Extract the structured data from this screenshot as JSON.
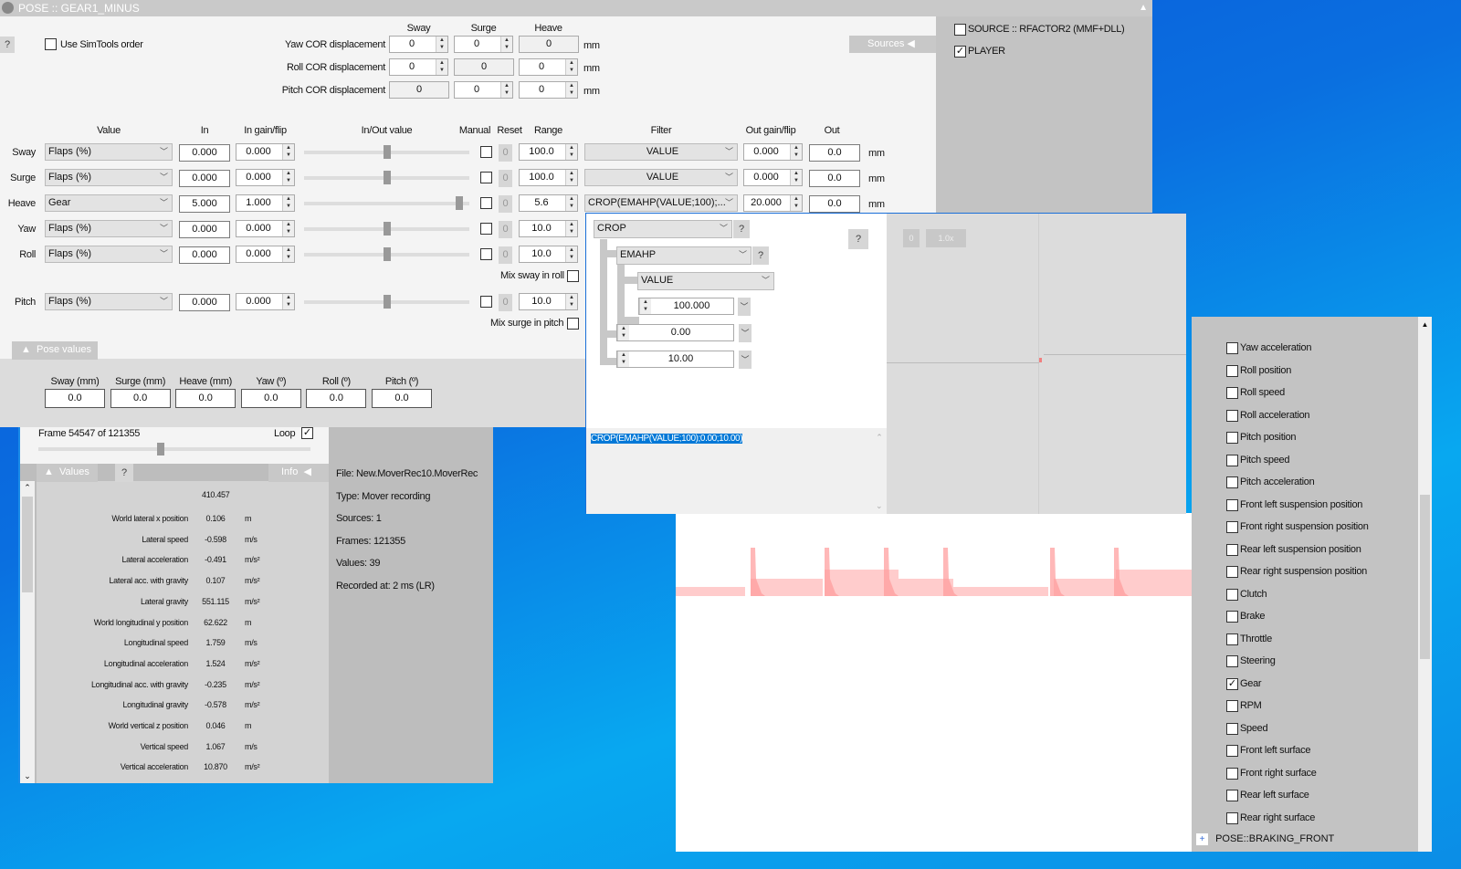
{
  "main_window": {
    "title": "POSE :: GEAR1_MINUS",
    "help": "?",
    "use_simtools_order": "Use SimTools order",
    "sources_button": "Sources",
    "cor": {
      "headers": [
        "Sway",
        "Surge",
        "Heave"
      ],
      "unit": "mm",
      "rows": [
        {
          "label": "Yaw COR displacement",
          "values": [
            "0",
            "0",
            "0"
          ],
          "disabled": [
            false,
            false,
            true
          ]
        },
        {
          "label": "Roll COR displacement",
          "values": [
            "0",
            "0",
            "0"
          ],
          "disabled": [
            false,
            true,
            false
          ]
        },
        {
          "label": "Pitch COR displacement",
          "values": [
            "0",
            "0",
            "0"
          ],
          "disabled": [
            true,
            false,
            false
          ]
        }
      ]
    },
    "columns": {
      "value": "Value",
      "in": "In",
      "in_gain": "In gain/flip",
      "inout": "In/Out value",
      "manual": "Manual",
      "reset": "Reset",
      "range": "Range",
      "filter": "Filter",
      "out_gain": "Out gain/flip",
      "out": "Out"
    },
    "channels": [
      {
        "label": "Sway",
        "value": "Flaps (%)",
        "in": "0.000",
        "gain": "0.000",
        "slider": 0.5,
        "manual": false,
        "reset": "0",
        "range": "100.0",
        "filter": "VALUE",
        "out_gain": "0.000",
        "out": "0.0",
        "unit": "mm"
      },
      {
        "label": "Surge",
        "value": "Flaps (%)",
        "in": "0.000",
        "gain": "0.000",
        "slider": 0.5,
        "manual": false,
        "reset": "0",
        "range": "100.0",
        "filter": "VALUE",
        "out_gain": "0.000",
        "out": "0.0",
        "unit": "mm"
      },
      {
        "label": "Heave",
        "value": "Gear",
        "in": "5.000",
        "gain": "1.000",
        "slider": 0.96,
        "manual": false,
        "reset": "0",
        "range": "5.6",
        "filter": "CROP(EMAHP(VALUE;100);...",
        "out_gain": "20.000",
        "out": "0.0",
        "unit": "mm"
      },
      {
        "label": "Yaw",
        "value": "Flaps (%)",
        "in": "0.000",
        "gain": "0.000",
        "slider": 0.5,
        "manual": false,
        "reset": "0",
        "range": "10.0"
      },
      {
        "label": "Roll",
        "value": "Flaps (%)",
        "in": "0.000",
        "gain": "0.000",
        "slider": 0.5,
        "manual": false,
        "reset": "0",
        "range": "10.0"
      },
      {
        "label": "Pitch",
        "value": "Flaps (%)",
        "in": "0.000",
        "gain": "0.000",
        "slider": 0.5,
        "manual": false,
        "reset": "0",
        "range": "10.0"
      }
    ],
    "mix_sway_in_roll": "Mix sway in roll",
    "mix_surge_in_pitch": "Mix surge in pitch",
    "pose_values": {
      "tab": "Pose values",
      "items": [
        {
          "label": "Sway (mm)",
          "value": "0.0"
        },
        {
          "label": "Surge (mm)",
          "value": "0.0"
        },
        {
          "label": "Heave (mm)",
          "value": "0.0"
        },
        {
          "label": "Yaw (º)",
          "value": "0.0"
        },
        {
          "label": "Roll (º)",
          "value": "0.0"
        },
        {
          "label": "Pitch (º)",
          "value": "0.0"
        }
      ]
    },
    "sources": [
      {
        "label": "SOURCE :: RFACTOR2 (MMF+DLL)",
        "checked": false
      },
      {
        "label": "PLAYER",
        "checked": true
      }
    ]
  },
  "filter_popup": {
    "help": "?",
    "crop": "CROP",
    "emahp": "EMAHP",
    "value": "VALUE",
    "param1": "100.000",
    "param2": "0.00",
    "param3": "10.00",
    "expression": "CROP(EMAHP(VALUE;100);0.00;10.00)",
    "zoom_reset": "0",
    "zoom_level": "1.0x"
  },
  "player": {
    "frame": "Frame 54547 of 121355",
    "loop": "Loop",
    "loop_checked": true,
    "frame_fraction": 0.449,
    "values_tab": "Values",
    "help": "?",
    "info_tab": "Info",
    "top_value": "410.457",
    "values": [
      [
        "World lateral x position",
        "0.106",
        "m"
      ],
      [
        "Lateral speed",
        "-0.598",
        "m/s"
      ],
      [
        "Lateral acceleration",
        "-0.491",
        "m/s²"
      ],
      [
        "Lateral acc. with gravity",
        "0.107",
        "m/s²"
      ],
      [
        "Lateral gravity",
        "551.115",
        "m/s²"
      ],
      [
        "World longitudinal y position",
        "62.622",
        "m"
      ],
      [
        "Longitudinal speed",
        "1.759",
        "m/s"
      ],
      [
        "Longitudinal acceleration",
        "1.524",
        "m/s²"
      ],
      [
        "Longitudinal acc. with gravity",
        "-0.235",
        "m/s²"
      ],
      [
        "Longitudinal gravity",
        "-0.578",
        "m/s²"
      ],
      [
        "World vertical z position",
        "0.046",
        "m"
      ],
      [
        "Vertical speed",
        "1.067",
        "m/s"
      ],
      [
        "Vertical acceleration",
        "10.870",
        "m/s²"
      ]
    ],
    "info": [
      "File: New.MoverRec10.MoverRec",
      "Type: Mover recording",
      "Sources: 1",
      "Frames: 121355",
      "Values: 39",
      "Recorded at: 2 ms (LR)"
    ]
  },
  "signal_list": {
    "items": [
      {
        "label": "Yaw acceleration",
        "checked": false
      },
      {
        "label": "Roll position",
        "checked": false
      },
      {
        "label": "Roll speed",
        "checked": false
      },
      {
        "label": "Roll acceleration",
        "checked": false
      },
      {
        "label": "Pitch position",
        "checked": false
      },
      {
        "label": "Pitch speed",
        "checked": false
      },
      {
        "label": "Pitch acceleration",
        "checked": false
      },
      {
        "label": "Front left suspension position",
        "checked": false
      },
      {
        "label": "Front right suspension position",
        "checked": false
      },
      {
        "label": "Rear left suspension position",
        "checked": false
      },
      {
        "label": "Rear right suspension position",
        "checked": false
      },
      {
        "label": "Clutch",
        "checked": false
      },
      {
        "label": "Brake",
        "checked": false
      },
      {
        "label": "Throttle",
        "checked": false
      },
      {
        "label": "Steering",
        "checked": false
      },
      {
        "label": "Gear",
        "checked": true
      },
      {
        "label": "RPM",
        "checked": false
      },
      {
        "label": "Speed",
        "checked": false
      },
      {
        "label": "Front left surface",
        "checked": false
      },
      {
        "label": "Front right surface",
        "checked": false
      },
      {
        "label": "Rear left surface",
        "checked": false
      },
      {
        "label": "Rear right surface",
        "checked": false
      }
    ],
    "next_pose": "POSE::BRAKING_FRONT"
  },
  "colors": {
    "graph_fill": "#ffcccc",
    "graph_spike": "#ff9a9a",
    "selection": "#0078d7"
  }
}
